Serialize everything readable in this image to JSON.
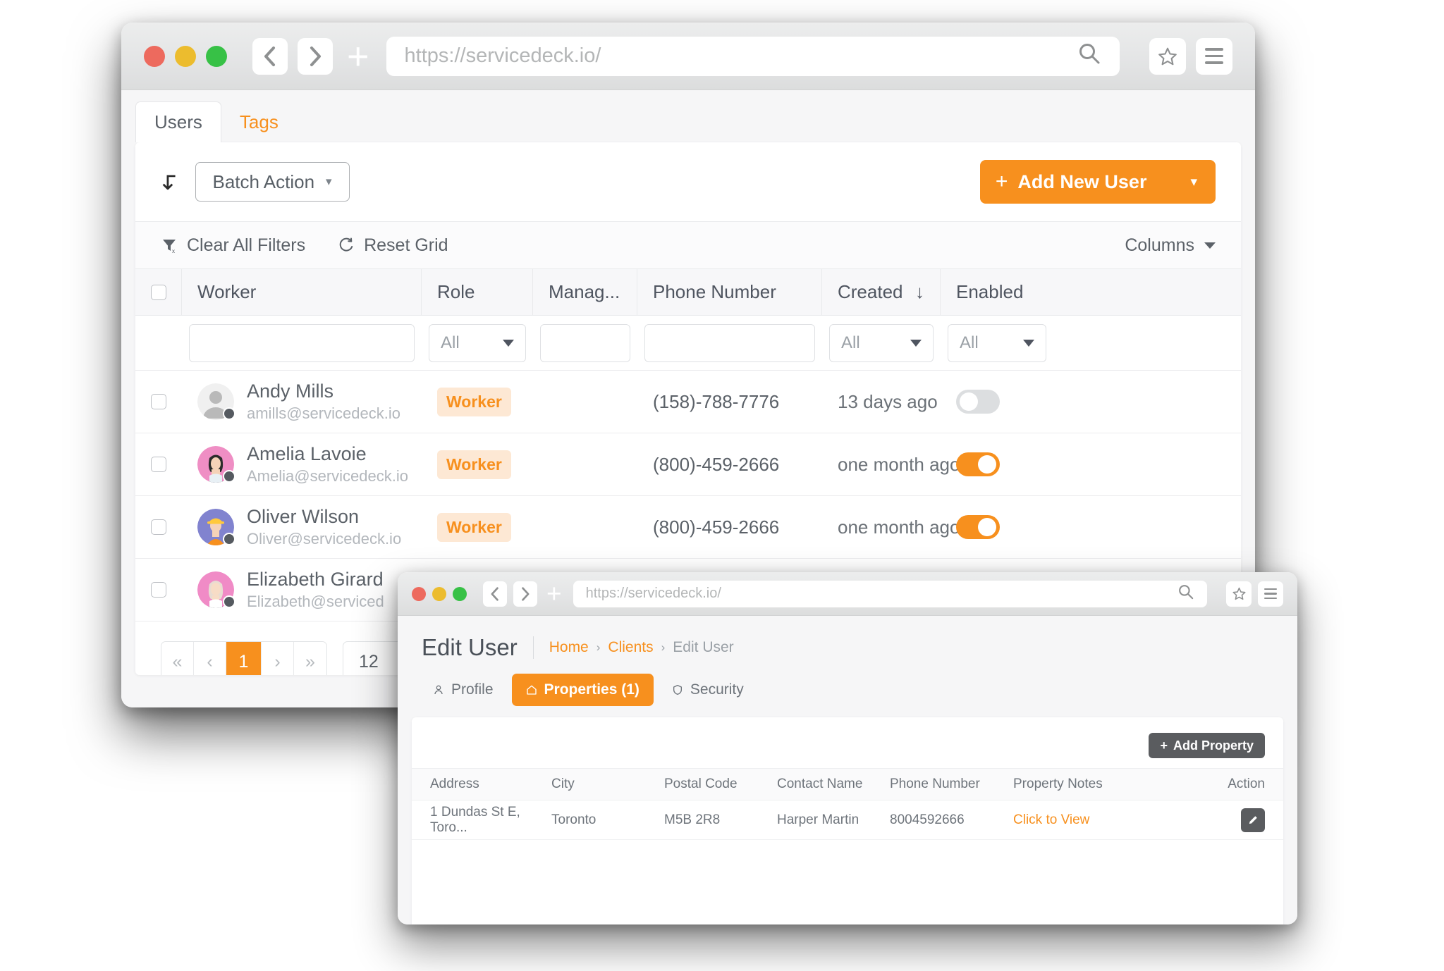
{
  "back_window": {
    "browser": {
      "url": "https://servicedeck.io/",
      "back_icon": "chevron-left-icon",
      "forward_icon": "chevron-right-icon",
      "new_tab_icon": "plus-icon",
      "search_icon": "search-icon",
      "bookmark_icon": "star-icon",
      "menu_icon": "hamburger-icon"
    },
    "tabs": [
      {
        "label": "Users",
        "active": true
      },
      {
        "label": "Tags",
        "active": false
      }
    ],
    "toolbar": {
      "batch_action_label": "Batch Action",
      "add_new_user_label": "Add New User",
      "add_plus": "+"
    },
    "filter_bar": {
      "clear_all_filters": "Clear All Filters",
      "reset_grid": "Reset Grid",
      "columns": "Columns"
    },
    "grid": {
      "columns": [
        {
          "key": "worker",
          "label": "Worker"
        },
        {
          "key": "role",
          "label": "Role"
        },
        {
          "key": "manager",
          "label": "Manag..."
        },
        {
          "key": "phone",
          "label": "Phone Number"
        },
        {
          "key": "created",
          "label": "Created",
          "sort": "↓"
        },
        {
          "key": "enabled",
          "label": "Enabled"
        }
      ],
      "filters": {
        "worker": "",
        "role": "All",
        "manager": "",
        "phone": "",
        "created": "All",
        "enabled": "All"
      },
      "rows": [
        {
          "name": "Andy Mills",
          "email": "amills@servicedeck.io",
          "role": "Worker",
          "manager": "",
          "phone": "(158)-788-7776",
          "created": "13 days ago",
          "enabled": false,
          "avatar": "default-gray"
        },
        {
          "name": "Amelia Lavoie",
          "email": "Amelia@servicedeck.io",
          "role": "Worker",
          "manager": "",
          "phone": "(800)-459-2666",
          "created": "one month ago",
          "enabled": true,
          "avatar": "pink-woman"
        },
        {
          "name": "Oliver Wilson",
          "email": "Oliver@servicedeck.io",
          "role": "Worker",
          "manager": "",
          "phone": "(800)-459-2666",
          "created": "one month ago",
          "enabled": true,
          "avatar": "blue-worker"
        },
        {
          "name": "Elizabeth Girard",
          "email": "Elizabeth@serviced",
          "role": "",
          "manager": "",
          "phone": "",
          "created": "",
          "enabled": null,
          "avatar": "pink-woman2"
        }
      ]
    },
    "pagination": {
      "first": "«",
      "prev": "‹",
      "current": "1",
      "next": "›",
      "last": "»",
      "page_size": "12"
    }
  },
  "front_window": {
    "browser": {
      "url": "https://servicedeck.io/",
      "back_icon": "chevron-left-icon",
      "forward_icon": "chevron-right-icon",
      "new_tab_icon": "plus-icon",
      "search_icon": "search-icon",
      "bookmark_icon": "star-icon",
      "menu_icon": "hamburger-icon"
    },
    "page_title": "Edit User",
    "breadcrumb": [
      {
        "label": "Home",
        "link": true
      },
      {
        "label": "Clients",
        "link": true
      },
      {
        "label": "Edit User",
        "link": false
      }
    ],
    "breadcrumb_sep": "›",
    "tabs": [
      {
        "label": "Profile",
        "icon": "person-icon",
        "active": false
      },
      {
        "label": "Properties (1)",
        "icon": "home-icon",
        "active": true
      },
      {
        "label": "Security",
        "icon": "shield-icon",
        "active": false
      }
    ],
    "add_property_label": "Add Property",
    "properties_table": {
      "columns": [
        "Address",
        "City",
        "Postal Code",
        "Contact Name",
        "Phone Number",
        "Property Notes",
        "Action"
      ],
      "rows": [
        {
          "address": "1 Dundas St E, Toro...",
          "city": "Toronto",
          "postal_code": "M5B 2R8",
          "contact_name": "Harper Martin",
          "phone_number": "8004592666",
          "property_notes": "Click to View",
          "action_icon": "pencil-icon"
        }
      ]
    }
  },
  "colors": {
    "accent": "#f7901e",
    "badge_bg": "#fde8d4",
    "text": "#5b6168",
    "muted": "#b3b7bc",
    "dark_button": "#5a5c5f"
  }
}
